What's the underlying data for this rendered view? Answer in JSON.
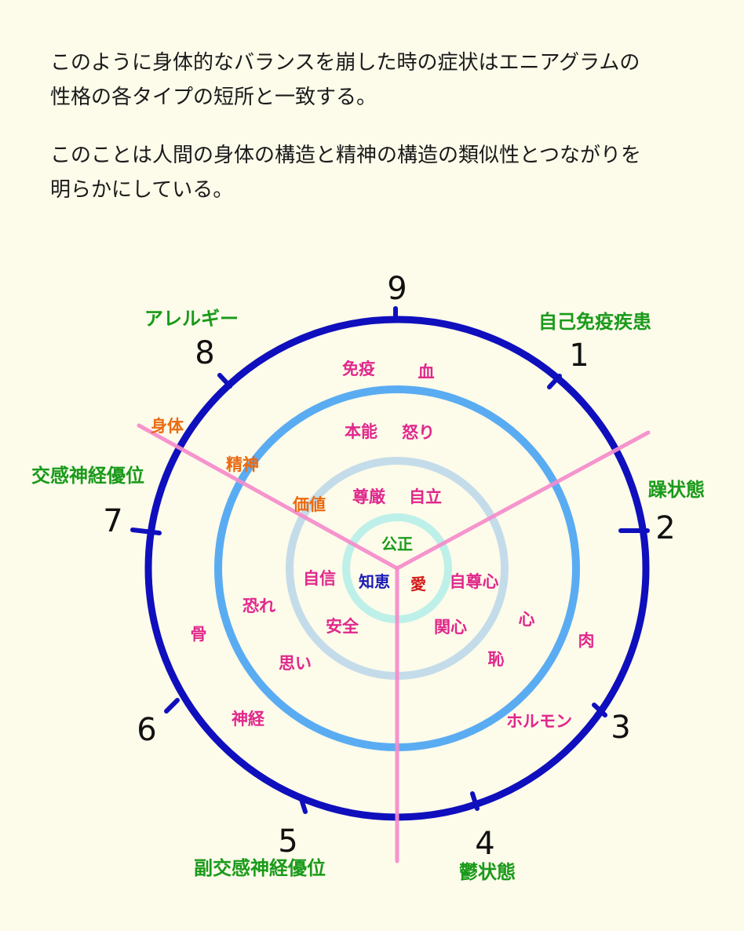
{
  "text": {
    "paragraph1_line1": "このように身体的なバランスを崩した時の症状はエニアグラムの",
    "paragraph1_line2": "性格の各タイプの短所と一致する。",
    "paragraph2_line1": "このことは人間の身体の構造と精神の構造の類似性とつながりを",
    "paragraph2_line2": "明らかにしている。"
  },
  "diagram": {
    "numbers": {
      "n1": "1",
      "n2": "2",
      "n3": "3",
      "n4": "4",
      "n5": "5",
      "n6": "6",
      "n7": "7",
      "n8": "8",
      "n9": "9"
    },
    "outer_labels": {
      "type1": "自己免疫疾患",
      "type2": "躁状態",
      "type4": "鬱状態",
      "type5": "副交感神経優位",
      "type7": "交感神経優位",
      "type8": "アレルギー"
    },
    "sector_labels": {
      "body": "身体",
      "mind": "精神",
      "value": "価値"
    },
    "body_ring": {
      "immunity": "免疫",
      "blood": "血",
      "bone": "骨",
      "nerve": "神経",
      "muscle": "肉",
      "hormone": "ホルモン"
    },
    "mind_ring": {
      "instinct": "本能",
      "anger": "怒り",
      "fear": "恐れ",
      "thought": "思い",
      "heart": "心",
      "shame": "恥"
    },
    "value_ring": {
      "dignity": "尊厳",
      "independence": "自立",
      "confidence": "自信",
      "safety": "安全",
      "self_esteem": "自尊心",
      "concern": "関心"
    },
    "core": {
      "justice": "公正",
      "wisdom": "知恵",
      "love": "愛"
    },
    "colors": {
      "outer_ring": "#0f0fbd",
      "mind_ring": "#5aacf2",
      "value_ring": "#c4dcea",
      "core_ring": "#bdf0e8",
      "divider": "#f58ccb"
    }
  }
}
